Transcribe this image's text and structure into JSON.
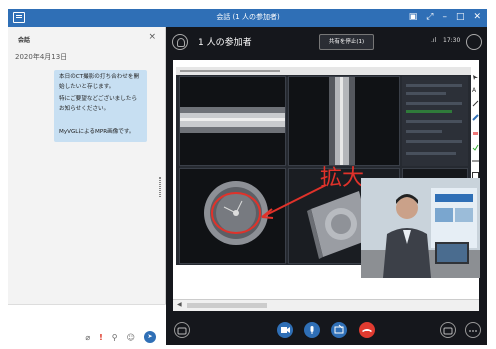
{
  "window": {
    "title": "会話 (1 人の参加者)",
    "controls": [
      "layout-icon",
      "expand-icon",
      "minimize-icon",
      "maximize-icon",
      "close-icon"
    ]
  },
  "chat": {
    "header_label": "会話",
    "close_label": "×",
    "date": "2020年4月13日",
    "messages": [
      {
        "lines": [
          "本日のCT撮影の打ち合わせを開始したいと存じます。",
          "特にご要望などございましたらお知らせください。"
        ]
      },
      {
        "lines": [
          "MyVGLによるMPR画像です。"
        ]
      }
    ],
    "input_tools": [
      "paperclip-icon",
      "priority-icon",
      "link-icon",
      "emoji-icon",
      "send-icon"
    ],
    "priority_glyph": "!"
  },
  "meeting": {
    "participant_count": "1 人の参加者",
    "stop_share_label": "共有を停止(1)",
    "signal": ".ıl",
    "time": "17:30",
    "annotation_text": "拡大",
    "call_controls": [
      "chat-icon",
      "camera-icon",
      "mic-icon",
      "share-icon",
      "hangup-icon",
      "device-icon",
      "more-icon"
    ]
  },
  "colors": {
    "title_bar": "#2f6fb6",
    "chat_bubble": "#c7dff2",
    "meeting_bg": "#15171c",
    "annotation": "#e0322a",
    "hangup": "#e03b30"
  }
}
